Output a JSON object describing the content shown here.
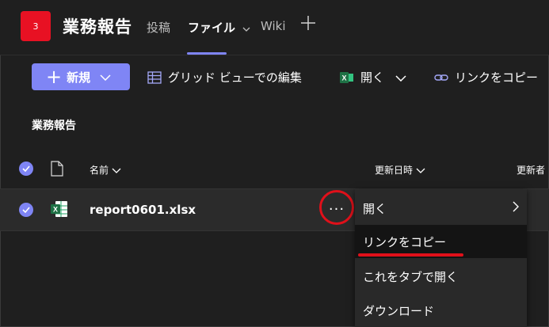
{
  "header": {
    "team_badge": "3",
    "channel_name": "業務報告",
    "tabs": [
      {
        "label": "投稿"
      },
      {
        "label": "ファイル"
      },
      {
        "label": "Wiki"
      }
    ]
  },
  "toolbar": {
    "new_label": "新規",
    "grid_view_label": "グリッド ビューでの編集",
    "open_label": "開く",
    "copy_link_label": "リンクをコピー"
  },
  "section": {
    "title": "業務報告"
  },
  "list": {
    "columns": [
      {
        "label": "名前"
      },
      {
        "label": "更新日時"
      },
      {
        "label": "更新者"
      }
    ],
    "rows": [
      {
        "name": "report0601.xlsx"
      }
    ]
  },
  "context_menu": {
    "items": [
      {
        "label": "開く"
      },
      {
        "label": "リンクをコピー"
      },
      {
        "label": "これをタブで開く"
      },
      {
        "label": "ダウンロード"
      }
    ]
  },
  "colors": {
    "accent": "#7f85f5",
    "team_badge": "#e81123",
    "annotation": "#e0101a",
    "excel_green": "#1e7145"
  }
}
